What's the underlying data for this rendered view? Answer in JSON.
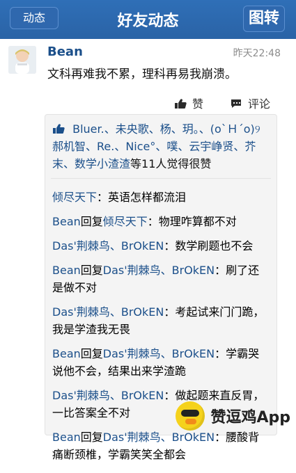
{
  "header": {
    "back": "动态",
    "title": "好友动态",
    "right": "图转"
  },
  "post": {
    "author": "Bean",
    "time": "昨天22:48",
    "text": "文科再难我不累，理科再易我崩溃。",
    "actions": {
      "like": "赞",
      "comment": "评论"
    },
    "likes_line1_names": "Bluer.、未央歌、杨、玥。、(o`Ｈ´o)୨",
    "likes_line2_names": "郝机智、Re.、Nice°、噗、云宇峥贤、芥",
    "likes_line3_names": "末、数学小渣渣",
    "likes_suffix": "等11人觉得很赞",
    "comments": [
      {
        "prefix": "",
        "from": "倾尽天下",
        "mid": "",
        "to": "",
        "text": "：英语怎样都流泪"
      },
      {
        "prefix": "Bean",
        "from": "回复",
        "mid": "倾尽天下",
        "to": "",
        "text": "：物理咋算都不对"
      },
      {
        "prefix": "",
        "from": "Das'荆棘鸟、BrOkEN",
        "mid": "",
        "to": "",
        "text": "：数学刷题也不会"
      },
      {
        "prefix": "Bean",
        "from": "回复",
        "mid": "Das'荆棘鸟、BrOkEN",
        "to": "",
        "text": "：刷了还是做不对"
      },
      {
        "prefix": "",
        "from": "Das'荆棘鸟、BrOkEN",
        "mid": "",
        "to": "",
        "text": "：考起试来门门跪，我是学渣我无畏"
      },
      {
        "prefix": "Bean",
        "from": "回复",
        "mid": "Das'荆棘鸟、BrOkEN",
        "to": "",
        "text": "：学霸哭说他不会，结果出来学渣跪"
      },
      {
        "prefix": "",
        "from": "Das'荆棘鸟、BrOkEN",
        "mid": "",
        "to": "",
        "text": "：做起题来直反胃，一比答案全不对"
      },
      {
        "prefix": "Bean",
        "from": "回复",
        "mid": "Das'荆棘鸟、BrOkEN",
        "to": "",
        "text": "：腰酸背痛断颈椎，学霸笑笑全都会"
      }
    ]
  },
  "brand": {
    "name": "赞逗鸡App"
  }
}
